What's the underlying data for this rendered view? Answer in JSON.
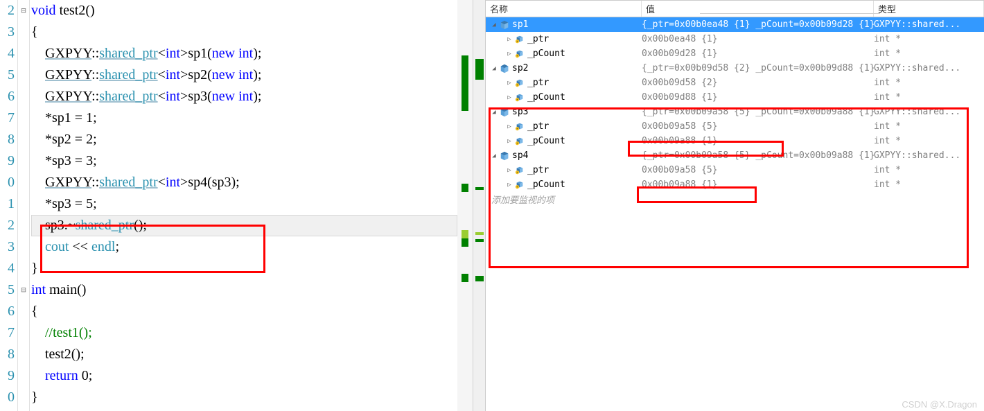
{
  "editor": {
    "lineStart": 2,
    "lines": [
      {
        "n": "2",
        "t": [
          {
            "c": "kw",
            "v": "void"
          },
          {
            "v": " test2()"
          }
        ]
      },
      {
        "n": "3",
        "t": [
          {
            "v": "{"
          }
        ]
      },
      {
        "n": "4",
        "t": [
          {
            "v": "    "
          },
          {
            "c": "ns-u",
            "v": "GXPYY"
          },
          {
            "v": "::"
          },
          {
            "c": "type-u",
            "v": "shared_ptr"
          },
          {
            "v": "<"
          },
          {
            "c": "kw",
            "v": "int"
          },
          {
            "v": ">sp1("
          },
          {
            "c": "kw",
            "v": "new"
          },
          {
            "v": " "
          },
          {
            "c": "kw",
            "v": "int"
          },
          {
            "v": ");"
          }
        ]
      },
      {
        "n": "5",
        "t": [
          {
            "v": "    "
          },
          {
            "c": "ns-u",
            "v": "GXPYY"
          },
          {
            "v": "::"
          },
          {
            "c": "type-u",
            "v": "shared_ptr"
          },
          {
            "v": "<"
          },
          {
            "c": "kw",
            "v": "int"
          },
          {
            "v": ">sp2("
          },
          {
            "c": "kw",
            "v": "new"
          },
          {
            "v": " "
          },
          {
            "c": "kw",
            "v": "int"
          },
          {
            "v": ");"
          }
        ]
      },
      {
        "n": "6",
        "t": [
          {
            "v": "    "
          },
          {
            "c": "ns-u",
            "v": "GXPYY"
          },
          {
            "v": "::"
          },
          {
            "c": "type-u",
            "v": "shared_ptr"
          },
          {
            "v": "<"
          },
          {
            "c": "kw",
            "v": "int"
          },
          {
            "v": ">sp3("
          },
          {
            "c": "kw",
            "v": "new"
          },
          {
            "v": " "
          },
          {
            "c": "kw",
            "v": "int"
          },
          {
            "v": ");"
          }
        ]
      },
      {
        "n": "7",
        "t": [
          {
            "v": "    *sp1 = 1;"
          }
        ]
      },
      {
        "n": "8",
        "t": [
          {
            "v": "    *sp2 = 2;"
          }
        ]
      },
      {
        "n": "9",
        "t": [
          {
            "v": "    *sp3 = 3;"
          }
        ]
      },
      {
        "n": "0",
        "t": [
          {
            "v": "    "
          },
          {
            "c": "ns-u",
            "v": "GXPYY"
          },
          {
            "v": "::"
          },
          {
            "c": "type-u",
            "v": "shared_ptr"
          },
          {
            "v": "<"
          },
          {
            "c": "kw",
            "v": "int"
          },
          {
            "v": ">sp4(sp3);"
          }
        ]
      },
      {
        "n": "1",
        "t": [
          {
            "v": "    *sp3 = 5;"
          }
        ]
      },
      {
        "n": "2",
        "t": [
          {
            "v": "    sp3.~"
          },
          {
            "c": "type",
            "v": "shared_ptr"
          },
          {
            "v": "();"
          }
        ],
        "current": true
      },
      {
        "n": "3",
        "t": [
          {
            "v": "    "
          },
          {
            "c": "type",
            "v": "cout"
          },
          {
            "v": " << "
          },
          {
            "c": "type",
            "v": "endl"
          },
          {
            "v": ";"
          }
        ]
      },
      {
        "n": "4",
        "t": [
          {
            "v": "}"
          }
        ]
      },
      {
        "n": "5",
        "t": [
          {
            "c": "kw",
            "v": "int"
          },
          {
            "v": " main()"
          }
        ]
      },
      {
        "n": "6",
        "t": [
          {
            "v": "{"
          }
        ]
      },
      {
        "n": "7",
        "t": [
          {
            "v": "    "
          },
          {
            "c": "comment",
            "v": "//test1();"
          }
        ]
      },
      {
        "n": "8",
        "t": [
          {
            "v": "    test2();"
          }
        ]
      },
      {
        "n": "9",
        "t": [
          {
            "v": "    "
          },
          {
            "c": "kw",
            "v": "return"
          },
          {
            "v": " 0;"
          }
        ]
      },
      {
        "n": "0",
        "t": [
          {
            "v": "}"
          }
        ]
      }
    ]
  },
  "debugger": {
    "header": {
      "name": "名称",
      "value": "值",
      "type": "类型"
    },
    "rows": [
      {
        "level": 0,
        "exp": "down",
        "icon": "cube",
        "name": "sp1",
        "value": "{_ptr=0x00b0ea48 {1} _pCount=0x00b09d28 {1} }",
        "type": "GXPYY::shared...",
        "selected": true
      },
      {
        "level": 1,
        "exp": "right",
        "icon": "field",
        "name": "_ptr",
        "value": "0x00b0ea48 {1}",
        "type": "int *"
      },
      {
        "level": 1,
        "exp": "right",
        "icon": "field",
        "name": "_pCount",
        "value": "0x00b09d28 {1}",
        "type": "int *"
      },
      {
        "level": 0,
        "exp": "down",
        "icon": "cube",
        "name": "sp2",
        "value": "{_ptr=0x00b09d58 {2} _pCount=0x00b09d88 {1} }",
        "type": "GXPYY::shared..."
      },
      {
        "level": 1,
        "exp": "right",
        "icon": "field",
        "name": "_ptr",
        "value": "0x00b09d58 {2}",
        "type": "int *"
      },
      {
        "level": 1,
        "exp": "right",
        "icon": "field",
        "name": "_pCount",
        "value": "0x00b09d88 {1}",
        "type": "int *"
      },
      {
        "level": 0,
        "exp": "down",
        "icon": "cube",
        "name": "sp3",
        "value": "{_ptr=0x00b09a58 {5} _pCount=0x00b09a88 {1} }",
        "type": "GXPYY::shared..."
      },
      {
        "level": 1,
        "exp": "right",
        "icon": "field",
        "name": "_ptr",
        "value": "0x00b09a58 {5}",
        "type": "int *"
      },
      {
        "level": 1,
        "exp": "right",
        "icon": "field",
        "name": "_pCount",
        "value": "0x00b09a88 {1}",
        "type": "int *"
      },
      {
        "level": 0,
        "exp": "down",
        "icon": "cube",
        "name": "sp4",
        "value": "{_ptr=0x00b09a58 {5} _pCount=0x00b09a88 {1} }",
        "type": "GXPYY::shared..."
      },
      {
        "level": 1,
        "exp": "right",
        "icon": "field",
        "name": "_ptr",
        "value": "0x00b09a58 {5}",
        "type": "int *"
      },
      {
        "level": 1,
        "exp": "right",
        "icon": "field",
        "name": "_pCount",
        "value": "0x00b09a88 {1}",
        "type": "int *"
      }
    ],
    "addWatch": "添加要监视的项"
  },
  "watermark": "CSDN @X.Dragon"
}
